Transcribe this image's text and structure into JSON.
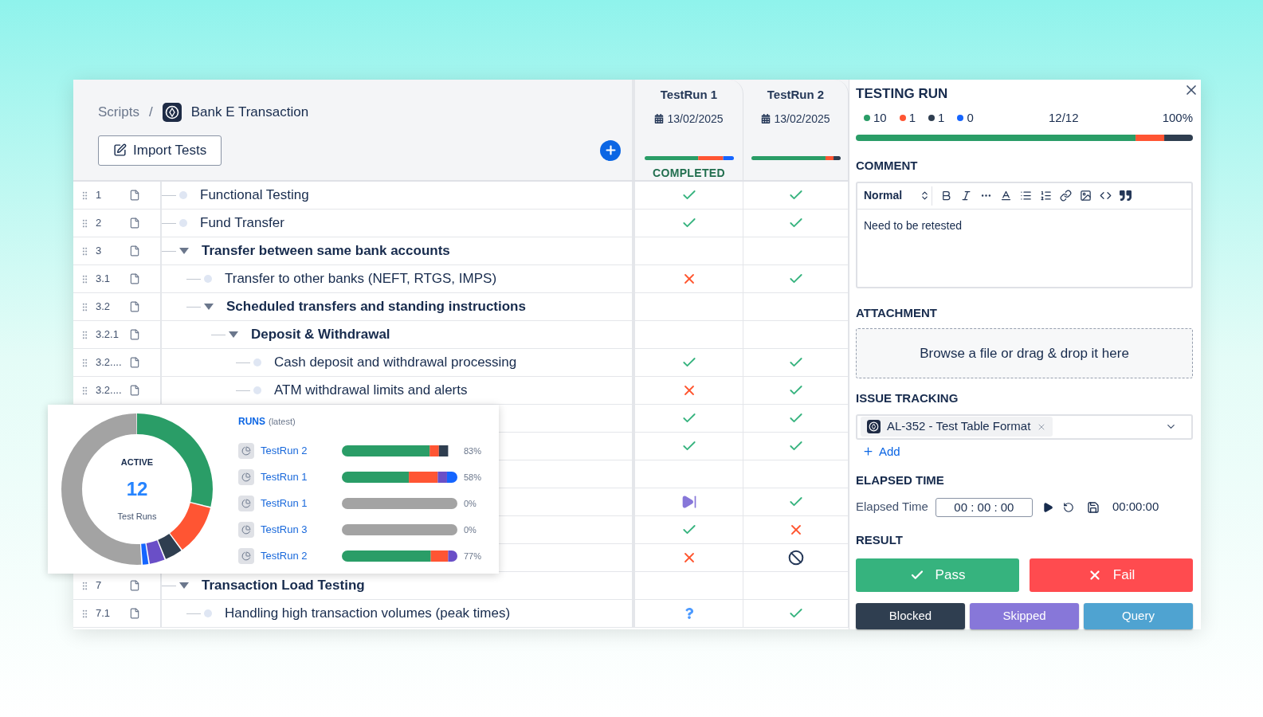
{
  "breadcrumb": {
    "parent": "Scripts",
    "separator": "/",
    "current": "Bank E Transaction"
  },
  "import_button": "Import Tests",
  "runs": [
    {
      "name": "TestRun 1",
      "date": "13/02/2025",
      "status": "COMPLETED"
    },
    {
      "name": "TestRun 2",
      "date": "13/02/2025"
    }
  ],
  "rows": [
    {
      "number": "1",
      "title": "Functional Testing",
      "results": [
        {
          "kind": "pass"
        },
        {
          "kind": "pass"
        }
      ]
    },
    {
      "number": "2",
      "title": "Fund Transfer",
      "results": [
        {
          "kind": "pass"
        },
        {
          "kind": "pass"
        }
      ]
    },
    {
      "number": "3",
      "title": "Transfer between same bank accounts",
      "expanded": true,
      "results": [
        {
          "kind": "none"
        },
        {
          "kind": "none"
        }
      ],
      "children": [
        {
          "number": "3.1",
          "title": "Transfer to other banks (NEFT, RTGS, IMPS)",
          "results": [
            {
              "kind": "fail"
            },
            {
              "kind": "pass"
            }
          ]
        },
        {
          "number": "3.2",
          "title": "Scheduled transfers and standing instructions",
          "expanded": true,
          "results": [
            {
              "kind": "none"
            },
            {
              "kind": "none"
            }
          ],
          "children": [
            {
              "number": "3.2.1",
              "title": "Deposit & Withdrawal",
              "expanded": true,
              "results": [
                {
                  "kind": "none"
                },
                {
                  "kind": "none"
                }
              ],
              "children": [
                {
                  "number": "3.2....",
                  "title": "Cash deposit and withdrawal processing",
                  "results": [
                    {
                      "kind": "pass"
                    },
                    {
                      "kind": "pass"
                    }
                  ]
                },
                {
                  "number": "3.2....",
                  "title": "ATM withdrawal limits and alerts",
                  "results": [
                    {
                      "kind": "fail"
                    },
                    {
                      "kind": "pass"
                    }
                  ]
                }
              ]
            }
          ]
        }
      ]
    },
    {
      "results": [
        {
          "kind": "pass"
        },
        {
          "kind": "pass"
        }
      ]
    },
    {
      "results": [
        {
          "kind": "pass"
        },
        {
          "kind": "pass"
        }
      ]
    },
    {
      "results": [
        {
          "kind": "none"
        },
        {
          "kind": "none"
        }
      ]
    },
    {
      "results": [
        {
          "kind": "skipped"
        },
        {
          "kind": "pass"
        }
      ]
    },
    {
      "results": [
        {
          "kind": "pass"
        },
        {
          "kind": "fail"
        }
      ]
    },
    {
      "results": [
        {
          "kind": "fail"
        },
        {
          "kind": "blocked"
        }
      ]
    },
    {
      "number": "7",
      "title": "Transaction Load Testing",
      "expanded": true,
      "results": [
        {
          "kind": "none"
        },
        {
          "kind": "none"
        }
      ],
      "children": [
        {
          "number": "7.1",
          "title": "Handling high transaction volumes (peak times)",
          "results": [
            {
              "kind": "query"
            },
            {
              "kind": "pass"
            }
          ]
        }
      ]
    }
  ],
  "panel": {
    "title": "TESTING RUN",
    "counts": [
      {
        "color": "#2a9d67",
        "value": "10"
      },
      {
        "color": "#ff5533",
        "value": "1"
      },
      {
        "color": "#2f3e50",
        "value": "1"
      },
      {
        "color": "#1565ff",
        "value": "0"
      }
    ],
    "progress": "12/12",
    "percent": "100%",
    "comment": {
      "label": "COMMENT",
      "format": "Normal",
      "text": "Need to be retested"
    },
    "attachment": {
      "label": "ATTACHMENT",
      "hint": "Browse a file or drag & drop it here"
    },
    "issues": {
      "label": "ISSUE TRACKING",
      "tags": [
        "AL-352 - Test Table Format"
      ],
      "add": "Add"
    },
    "elapsed": {
      "label": "ELAPSED TIME",
      "field_label": "Elapsed Time",
      "value": "00 : 00 : 00",
      "total": "00:00:00"
    },
    "result": {
      "label": "RESULT",
      "buttons": [
        {
          "kind": "pass",
          "label": "Pass"
        },
        {
          "kind": "fail",
          "label": "Fail"
        },
        {
          "kind": "blocked",
          "label": "Blocked"
        },
        {
          "kind": "skipped",
          "label": "Skipped"
        },
        {
          "kind": "query",
          "label": "Query"
        }
      ]
    }
  },
  "popup": {
    "status": "ACTIVE",
    "count": "12",
    "count_label": "Test Runs",
    "runs_title": "RUNS",
    "runs_note": "(latest)",
    "runs": [
      {
        "name": "TestRun 2",
        "percent": "83%"
      },
      {
        "name": "TestRun 1",
        "percent": "58%"
      },
      {
        "name": "TestRun 1",
        "percent": "0%"
      },
      {
        "name": "TestRun 3",
        "percent": "0%"
      },
      {
        "name": "TestRun 2",
        "percent": "77%"
      }
    ]
  }
}
